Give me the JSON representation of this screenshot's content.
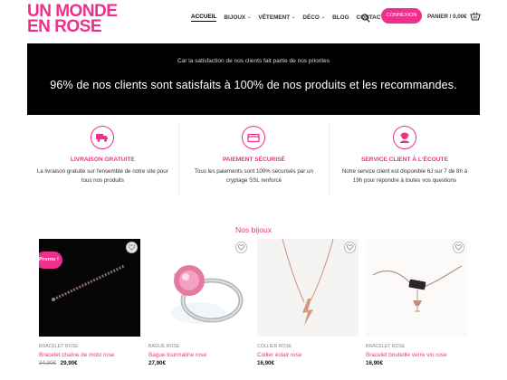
{
  "brand": {
    "logo_line1": "UN MONDE",
    "logo_line2": "EN ROSE",
    "accent": "#ef2f8c"
  },
  "nav": {
    "items": [
      {
        "label": "ACCUEIL",
        "active": true,
        "dropdown": false
      },
      {
        "label": "BIJOUX",
        "active": false,
        "dropdown": true
      },
      {
        "label": "VÊTEMENT",
        "active": false,
        "dropdown": true
      },
      {
        "label": "DÉCO",
        "active": false,
        "dropdown": true
      },
      {
        "label": "BLOG",
        "active": false,
        "dropdown": false
      },
      {
        "label": "CONTACT",
        "active": false,
        "dropdown": false
      }
    ],
    "login_label": "CONNEXION",
    "cart_label": "PANIER / 0,00€",
    "search_icon": "search-icon",
    "cart_icon": "basket-icon"
  },
  "banner": {
    "subtitle": "Car la satisfaction de nos clients fait partie de nos priorites",
    "title": "96% de nos clients sont satisfaits à 100% de nos produits et les recommandes."
  },
  "features": [
    {
      "icon": "truck-icon",
      "title": "LIVRAISON GRATUITE",
      "desc": "La livraison gratuite sur l'ensemble de notre site pour tous nos produits"
    },
    {
      "icon": "credit-card-icon",
      "title": "PAIEMENT SÉCURISÉ",
      "desc": "Tous les paiements sont 100% sécurisés par un cryptage SSL renforcé"
    },
    {
      "icon": "support-agent-icon",
      "title": "SERVICE CLIENT À L'ÉCOUTE",
      "desc": "Notre service client est disponible 6J sur 7 de 8h à 19h pour répondre à toutes vos questions"
    }
  ],
  "section_title": "Nos bijoux",
  "products": [
    {
      "category": "BRACELET ROSE",
      "name": "Bracelet chaîne de moto rose",
      "old_price": "34,90€",
      "price": "29,90€",
      "badge": "Promo !"
    },
    {
      "category": "BAGUE ROSE",
      "name": "Bague tourmaline rose",
      "old_price": "",
      "price": "27,90€",
      "badge": ""
    },
    {
      "category": "COLLIER ROSE",
      "name": "Collier éclair rose",
      "old_price": "",
      "price": "16,90€",
      "badge": ""
    },
    {
      "category": "BRACELET ROSE",
      "name": "Bracelet bouteille verre vin rose",
      "old_price": "",
      "price": "16,90€",
      "badge": ""
    }
  ]
}
